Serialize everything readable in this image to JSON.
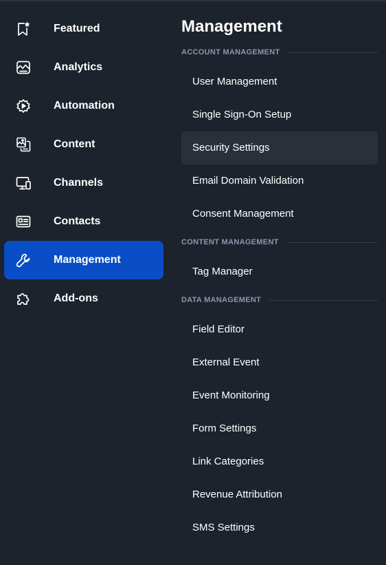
{
  "nav": {
    "items": [
      {
        "label": "Featured",
        "icon": "bookmark-star-icon"
      },
      {
        "label": "Analytics",
        "icon": "line-chart-icon"
      },
      {
        "label": "Automation",
        "icon": "automation-gear-icon"
      },
      {
        "label": "Content",
        "icon": "content-images-icon"
      },
      {
        "label": "Channels",
        "icon": "devices-icon"
      },
      {
        "label": "Contacts",
        "icon": "contact-card-icon"
      },
      {
        "label": "Management",
        "icon": "wrench-icon",
        "active": true
      },
      {
        "label": "Add-ons",
        "icon": "puzzle-piece-icon"
      }
    ]
  },
  "panel": {
    "title": "Management",
    "sections": [
      {
        "label": "ACCOUNT MANAGEMENT",
        "items": [
          {
            "label": "User Management"
          },
          {
            "label": "Single Sign-On Setup"
          },
          {
            "label": "Security Settings",
            "selected": true
          },
          {
            "label": "Email Domain Validation"
          },
          {
            "label": "Consent Management"
          }
        ]
      },
      {
        "label": "CONTENT MANAGEMENT",
        "items": [
          {
            "label": "Tag Manager"
          }
        ]
      },
      {
        "label": "DATA MANAGEMENT",
        "items": [
          {
            "label": "Field Editor"
          },
          {
            "label": "External Event"
          },
          {
            "label": "Event Monitoring"
          },
          {
            "label": "Form Settings"
          },
          {
            "label": "Link Categories"
          },
          {
            "label": "Revenue Attribution"
          },
          {
            "label": "SMS Settings"
          }
        ]
      }
    ]
  },
  "colors": {
    "background": "#1d232c",
    "active_nav": "#0a4ec7",
    "selected_item": "#2a3039",
    "section_label": "#8a97ab"
  }
}
